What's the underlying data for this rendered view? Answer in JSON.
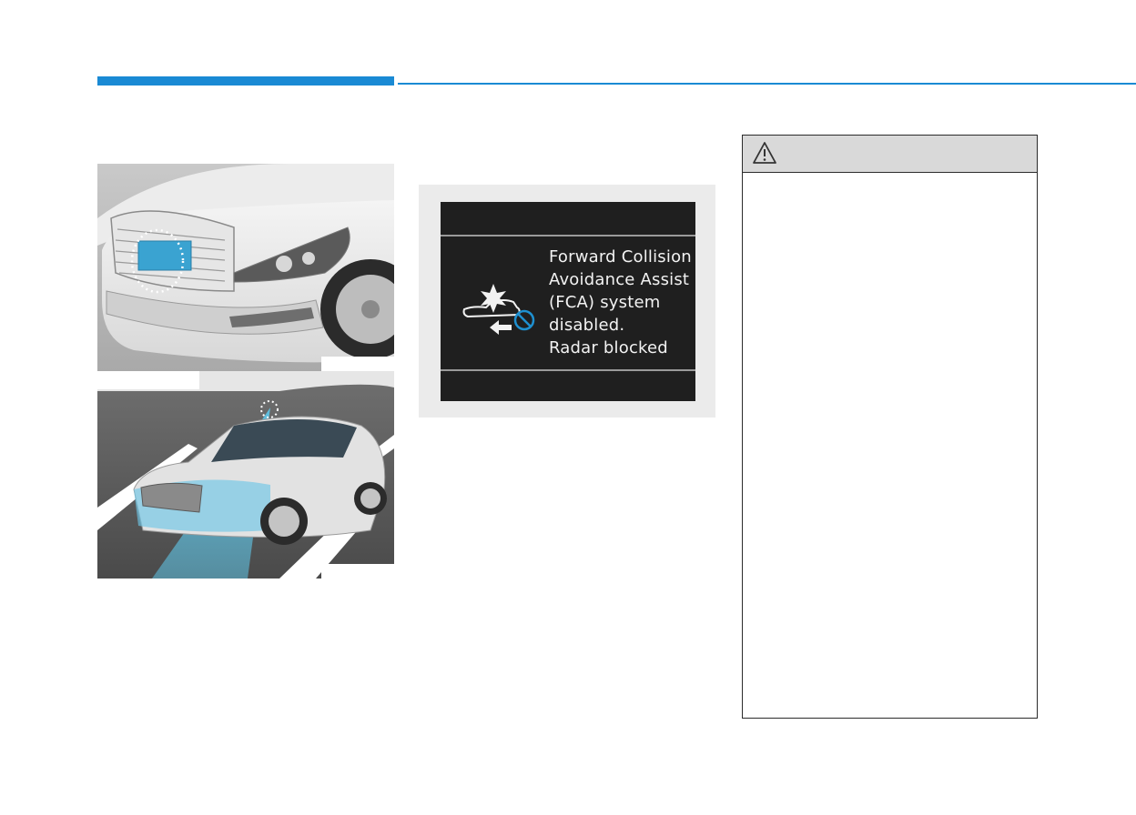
{
  "header": {
    "accent_color": "#1a8ad4"
  },
  "figures": [
    {
      "name": "front-grille-radar",
      "icon": "car-front-radar-illustration"
    },
    {
      "name": "side-view-radar-coverage",
      "icon": "car-side-radar-illustration",
      "highlight_color": "#5fc3e4"
    }
  ],
  "cluster_message": {
    "lines": [
      "Forward Collision",
      "Avoidance Assist",
      "(FCA) system",
      "disabled.",
      "Radar blocked"
    ],
    "icon": "fca-disabled-icon",
    "prohibited_color": "#1e90d0"
  },
  "warning": {
    "title": "",
    "icon": "warning-triangle-icon"
  }
}
